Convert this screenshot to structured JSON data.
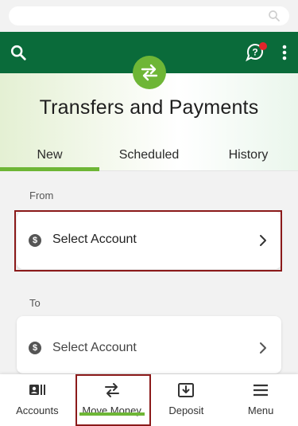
{
  "header": {
    "title": "Transfers and Payments",
    "search_icon": "search-icon",
    "help_icon": "chat-help-icon",
    "menu_icon": "more-vert-icon"
  },
  "tabs": [
    {
      "label": "New",
      "active": true
    },
    {
      "label": "Scheduled",
      "active": false
    },
    {
      "label": "History",
      "active": false
    }
  ],
  "transfer": {
    "from_label": "From",
    "from_value": "Select Account",
    "to_label": "To",
    "to_value": "Select Account"
  },
  "bottom_nav": [
    {
      "label": "Accounts",
      "icon": "accounts-icon"
    },
    {
      "label": "Move Money",
      "icon": "swap-icon",
      "active": true
    },
    {
      "label": "Deposit",
      "icon": "deposit-icon"
    },
    {
      "label": "Menu",
      "icon": "hamburger-icon"
    }
  ],
  "colors": {
    "brand_green": "#0a6b3a",
    "accent_green": "#6eb636",
    "notification_red": "#e1242a",
    "highlight_border": "#8b1a1a"
  }
}
